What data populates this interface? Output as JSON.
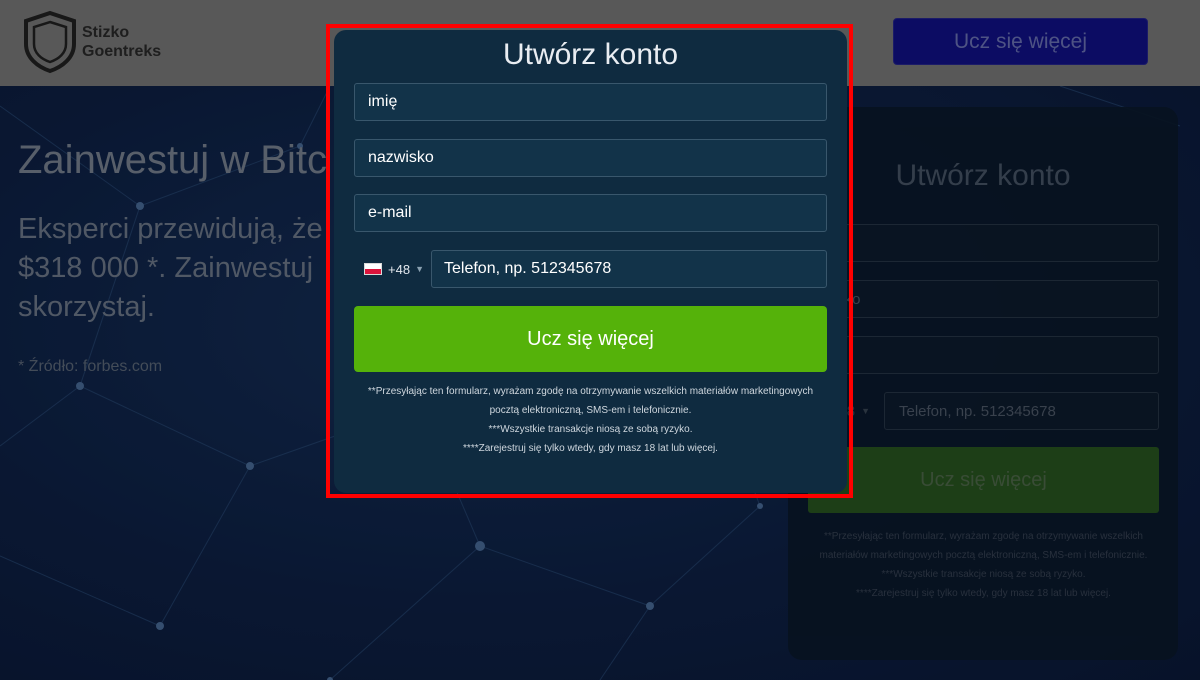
{
  "header": {
    "brand_line1": "Stizko",
    "brand_line2": "Goentreks",
    "cta_label": "Ucz się więcej"
  },
  "hero": {
    "title": "Zainwestuj w Bitc",
    "subtitle_line1": "Eksperci przewidują, że",
    "subtitle_line2": "$318 000 *. Zainwestuj",
    "subtitle_line3": "skorzystaj.",
    "source": "* Źródło: forbes.com"
  },
  "side_form": {
    "title": "Utwórz konto",
    "first_name_partial": "",
    "last_name_partial": "wisko",
    "email_partial": "ail",
    "prefix_partial": "8",
    "phone_placeholder": "Telefon, np.  512345678",
    "submit_label": "Ucz się więcej",
    "disclaimer_line1": "**Przesyłając ten formularz, wyrażam zgodę na otrzymywanie wszelkich",
    "disclaimer_line2": "materiałów marketingowych pocztą elektroniczną, SMS-em i telefonicznie.",
    "disclaimer_line3": "***Wszystkie transakcje niosą ze sobą ryzyko.",
    "disclaimer_line4": "****Zarejestruj się tylko wtedy, gdy masz 18 lat lub więcej."
  },
  "modal": {
    "title": "Utwórz konto",
    "first_name_placeholder": "imię",
    "last_name_placeholder": "nazwisko",
    "email_placeholder": "e-mail",
    "country_flag": "pl-flag-icon",
    "dial_code": "+48",
    "phone_placeholder": "Telefon, np.  512345678",
    "submit_label": "Ucz się więcej",
    "disclaimer_line1": "**Przesyłając ten formularz, wyrażam zgodę na otrzymywanie wszelkich materiałów marketingowych",
    "disclaimer_line2": "pocztą elektroniczną, SMS-em i telefonicznie.",
    "disclaimer_line3": "***Wszystkie transakcje niosą ze sobą ryzyko.",
    "disclaimer_line4": "****Zarejestruj się tylko wtedy, gdy masz 18 lat lub więcej."
  },
  "colors": {
    "submit_green": "#55b20a",
    "modal_bg": "#0f2b40",
    "highlight_border": "#ff0000",
    "header_cta": "#11118a"
  }
}
